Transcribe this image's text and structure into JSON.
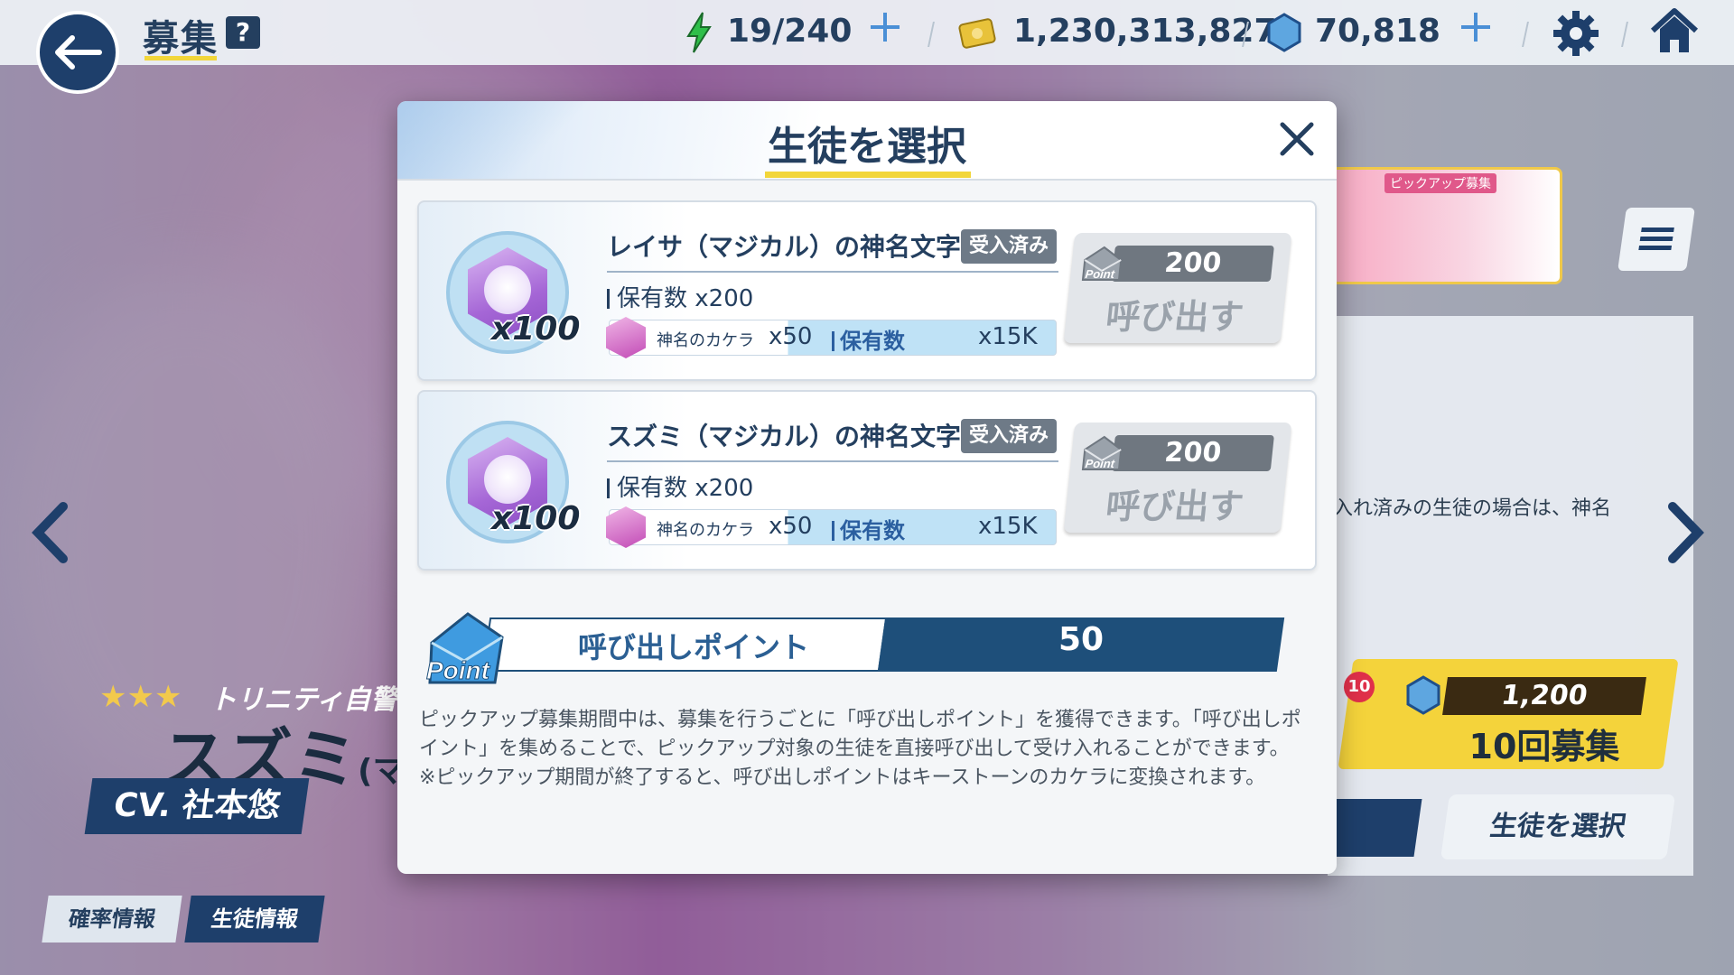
{
  "topbar": {
    "title": "募集",
    "help": "?",
    "ap": "19/240",
    "credits": "1,230,313,827",
    "pyroxene": "70,818"
  },
  "background": {
    "banner_tag": "ピックアップ募集",
    "panel_text": "入れ済みの生徒の場合は、神名",
    "ten_badge": "10",
    "ten_cost": "1,200",
    "ten_label": "10回募集",
    "select_button": "生徒を選択",
    "character": {
      "stars": "★★★",
      "school": "トリニティ自警団",
      "name": "スズミ",
      "name_suffix": "(マジ",
      "cv": "CV. 社本悠"
    },
    "tabs": [
      "確率情報",
      "生徒情報"
    ]
  },
  "modal": {
    "title": "生徒を選択",
    "cards": [
      {
        "qty": "x100",
        "name": "レイサ（マジカル）の神名文字",
        "badge": "受入済み",
        "owned": "保有数 x200",
        "frag_name": "神名のカケラ",
        "frag_qty": "x50",
        "frag_owned_label": "保有数",
        "frag_owned_value": "x15K",
        "cost": "200",
        "point_icon_label": "Point",
        "button": "呼び出す"
      },
      {
        "qty": "x100",
        "name": "スズミ（マジカル）の神名文字",
        "badge": "受入済み",
        "owned": "保有数 x200",
        "frag_name": "神名のカケラ",
        "frag_qty": "x50",
        "frag_owned_label": "保有数",
        "frag_owned_value": "x15K",
        "cost": "200",
        "point_icon_label": "Point",
        "button": "呼び出す"
      }
    ],
    "point_icon_label": "Point",
    "points_label": "呼び出しポイント",
    "points_value": "50",
    "description": [
      "ピックアップ募集期間中は、募集を行うごとに「呼び出しポイント」を獲得できます。「呼び出しポイント」を集めることで、ピックアップ対象の生徒を直接呼び出して受け入れることができます。",
      "※ピックアップ期間が終了すると、呼び出しポイントはキーストーンのカケラに変換されます。"
    ]
  },
  "colors": {
    "navy": "#1e3f6b",
    "accent_yellow": "#f2d63a",
    "plus_blue": "#4a8fd6",
    "badge_gray": "#6e7a87"
  },
  "icons": [
    "back-arrow-icon",
    "help-icon",
    "ap-icon",
    "credit-icon",
    "pyroxene-icon",
    "plus-icon",
    "gear-icon",
    "home-icon",
    "close-icon",
    "menu-icon",
    "arrow-left-icon",
    "arrow-right-icon",
    "point-envelope-icon",
    "fragment-icon"
  ]
}
